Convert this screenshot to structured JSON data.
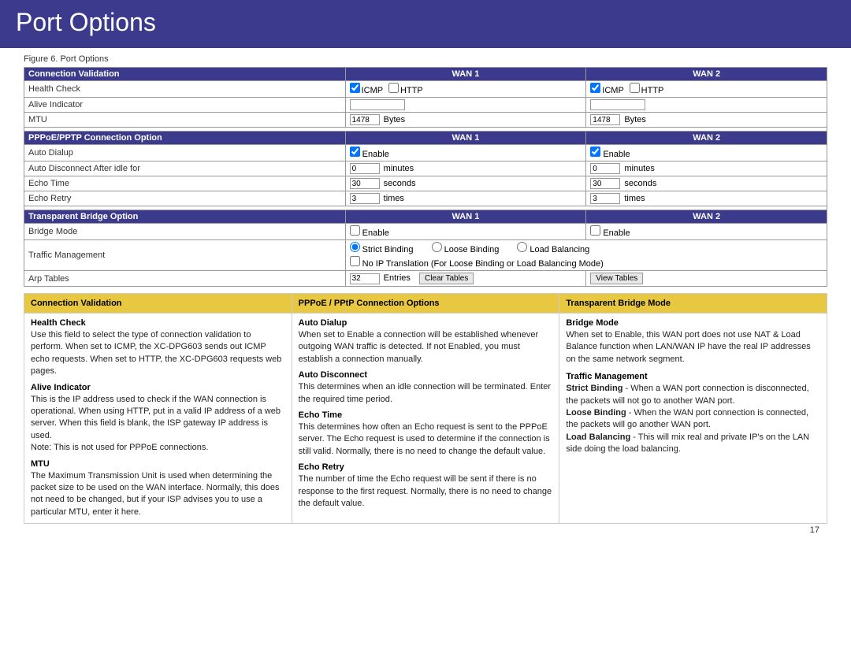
{
  "header": {
    "title": "Port Options"
  },
  "figure_label": "Figure 6.  Port Options",
  "port_table": {
    "section1": {
      "label": "Connection Validation",
      "wan1": "WAN 1",
      "wan2": "WAN 2",
      "rows": [
        {
          "field": "Health Check",
          "wan1_val": "",
          "wan2_val": ""
        },
        {
          "field": "Alive Indicator",
          "wan1_val": "",
          "wan2_val": ""
        },
        {
          "field": "MTU",
          "wan1_val": "1478",
          "wan1_unit": "Bytes",
          "wan2_val": "1478",
          "wan2_unit": "Bytes"
        }
      ]
    },
    "section2": {
      "label": "PPPoE/PPTP Connection Option",
      "wan1": "WAN 1",
      "wan2": "WAN 2",
      "rows": [
        {
          "field": "Auto Dialup",
          "wan1_val": "Enable",
          "wan2_val": "Enable"
        },
        {
          "field": "Auto Disconnect After idle for",
          "wan1_val": "0",
          "wan1_unit": "minutes",
          "wan2_val": "0",
          "wan2_unit": "minutes"
        },
        {
          "field": "Echo Time",
          "wan1_val": "30",
          "wan1_unit": "seconds",
          "wan2_val": "30",
          "wan2_unit": "seconds"
        },
        {
          "field": "Echo Retry",
          "wan1_val": "3",
          "wan1_unit": "times",
          "wan2_val": "3",
          "wan2_unit": "times"
        }
      ]
    },
    "section3": {
      "label": "Transparent Bridge Option",
      "wan1": "WAN 1",
      "wan2": "WAN 2",
      "rows": [
        {
          "field": "Bridge Mode",
          "wan1_val": "Enable",
          "wan2_val": "Enable"
        },
        {
          "field": "Traffic Management",
          "binding_options": [
            "Strict Binding",
            "Loose Binding",
            "Load Balancing"
          ],
          "no_ip_translation": "No IP Translation (For Loose Binding or Load Balancing Mode)"
        },
        {
          "field": "Arp Tables",
          "entries_val": "32",
          "entries_label": "Entries",
          "clear_btn": "Clear Tables",
          "view_btn": "View Tables"
        }
      ]
    }
  },
  "info_table": {
    "headers": [
      "Connection Validation",
      "PPPoE / PPtP Connection Options",
      "Transparent Bridge Mode"
    ],
    "col1": {
      "terms": [
        {
          "term": "Health Check",
          "desc": "Use this field to select the type of connection validation to perform. When set to ICMP, the XC-DPG603 sends out ICMP echo requests.  When set to HTTP, the XC-DPG603 requests web pages."
        },
        {
          "term": "Alive Indicator",
          "desc": "This is the IP address used to check if the WAN connection is operational. When using HTTP, put in a valid IP address of a web server. When this field is blank, the ISP gateway IP address is used.\nNote: This is not used for PPPoE connections."
        },
        {
          "term": "MTU",
          "desc": "The Maximum Transmission Unit is used when determining the packet size to be used on the WAN interface. Normally, this does not need to be changed, but if your ISP advises you to use a particular MTU, enter it here."
        }
      ]
    },
    "col2": {
      "terms": [
        {
          "term": "Auto Dialup",
          "desc": "When set to Enable a connection will be established whenever outgoing WAN traffic is detected. If not Enabled, you must establish a connection manually."
        },
        {
          "term": "Auto Disconnect",
          "desc": "This determines when an idle connection will be terminated. Enter the required time period."
        },
        {
          "term": "Echo Time",
          "desc": "This determines how often an Echo request is sent to the PPPoE server. The Echo request is used to determine if the connection is still valid. Normally, there is no need to change the default value."
        },
        {
          "term": "Echo Retry",
          "desc": "The number of time the Echo request will be sent if there is no response to the first request. Normally, there is no need to change the default value."
        }
      ]
    },
    "col3": {
      "terms": [
        {
          "term": "Bridge Mode",
          "desc": "When set to Enable, this WAN port does not use NAT & Load Balance function when LAN/WAN IP have the real IP addresses on the same network segment."
        },
        {
          "term": "Traffic Management",
          "desc": ""
        },
        {
          "term_inline": "Strict Binding",
          "desc_strict": " - When a WAN port connection is disconnected, the packets will not go to another WAN port."
        },
        {
          "term_inline": "Loose Binding",
          "desc_loose": " - When the WAN port connection is connected, the packets will go another WAN port."
        },
        {
          "term_inline": "Load Balancing",
          "desc_load": " - This will mix real and private IP's on the LAN side doing the load balancing."
        }
      ]
    }
  },
  "page_number": "17"
}
